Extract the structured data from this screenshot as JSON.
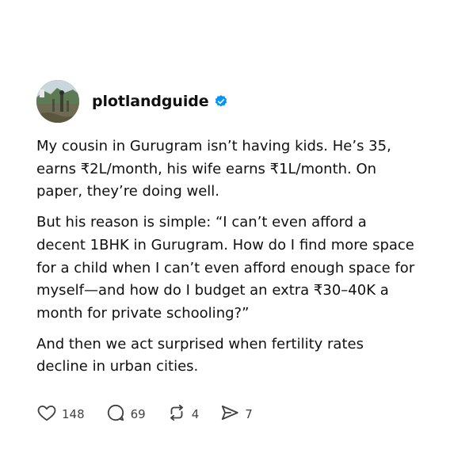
{
  "post": {
    "username": "plotlandguide",
    "verified": true,
    "paragraphs": [
      "My cousin in Gurugram isn’t having kids. He’s 35, earns ₹2L/month, his wife earns ₹1L/month. On paper, they’re doing well.",
      "But his reason is simple: “I can’t even afford a decent 1BHK in Gurugram. How do I find more space for a child when I can’t even afford enough space for myself—and how do I budget an extra ₹30–40K a month for private schooling?”",
      "And then we act surprised when fertility rates decline in urban cities."
    ],
    "actions": {
      "likes": "148",
      "comments": "69",
      "reposts": "4",
      "shares": "7"
    }
  },
  "colors": {
    "verified_badge": "#0095f6",
    "text": "#101010",
    "icon": "#424242"
  },
  "icons": [
    "heart-icon",
    "comment-icon",
    "repost-icon",
    "send-icon",
    "verified-badge-icon"
  ]
}
